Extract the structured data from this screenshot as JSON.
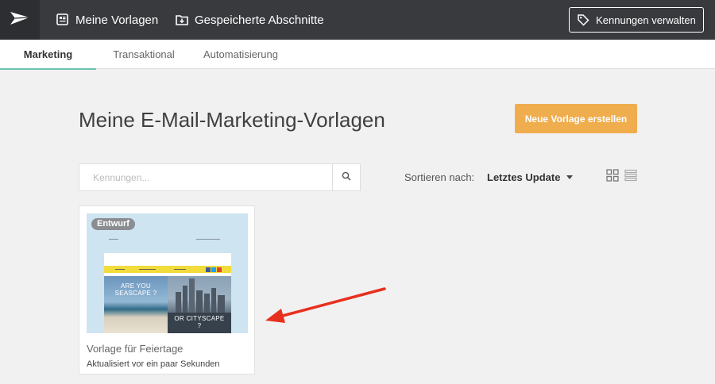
{
  "topnav": {
    "links": [
      {
        "label": "Meine Vorlagen",
        "icon": "template-list-icon"
      },
      {
        "label": "Gespeicherte Abschnitte",
        "icon": "folder-download-icon"
      }
    ],
    "manage_tags_label": "Kennungen verwalten",
    "manage_tags_icon": "tag-icon",
    "logo_icon": "paper-plane-icon",
    "colors": {
      "bar": "#383a3e",
      "logo_bg": "#2c2e31"
    }
  },
  "tabs": [
    {
      "label": "Marketing",
      "active": true
    },
    {
      "label": "Transaktional",
      "active": false
    },
    {
      "label": "Automatisierung",
      "active": false
    }
  ],
  "main": {
    "title": "Meine E-Mail-Marketing-Vorlagen",
    "new_template_label": "Neue Vorlage erstellen",
    "accent": "#f0ad4e",
    "search": {
      "placeholder": "Kennungen...",
      "value": "",
      "icon": "search-icon"
    },
    "sort": {
      "label": "Sortieren nach:",
      "selected": "Letztes Update"
    },
    "view_icons": [
      "grid-view-icon",
      "list-view-icon"
    ]
  },
  "templates": [
    {
      "badge": "Entwurf",
      "name": "Vorlage für Feiertage",
      "updated": "Aktualisiert vor ein paar Sekunden",
      "preview": {
        "hero_left_text": "ARE YOU SEASCAPE ?",
        "hero_right_text": "OR CITYSCAPE ?"
      }
    }
  ],
  "annotation": {
    "type": "arrow",
    "color": "#e8301f"
  }
}
